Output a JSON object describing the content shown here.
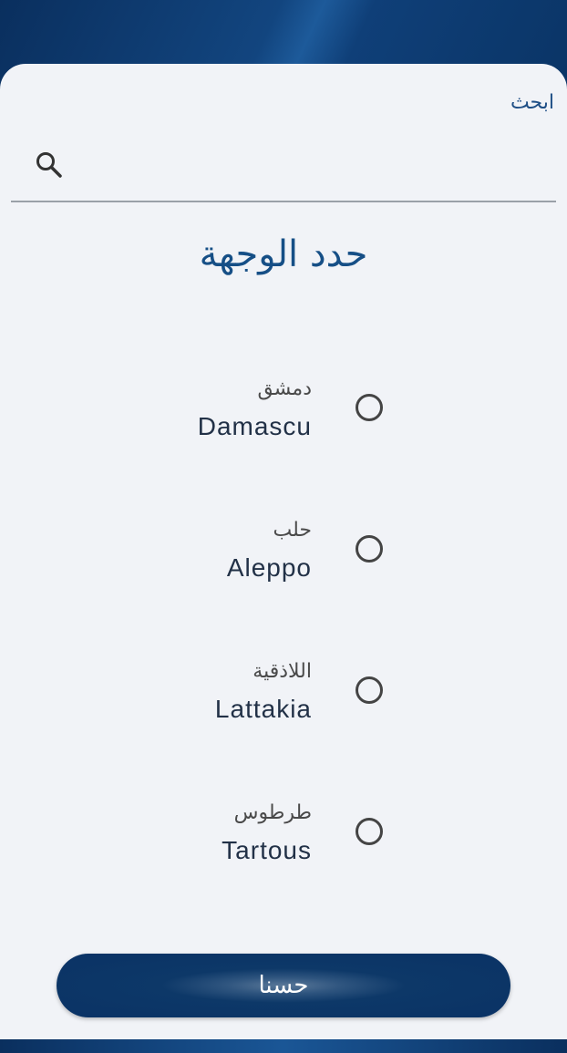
{
  "search": {
    "label": "ابحث",
    "icon": "search-icon"
  },
  "title": "حدد الوجهة",
  "options": [
    {
      "arabic": "دمشق",
      "english": "Damascu",
      "selected": false
    },
    {
      "arabic": "حلب",
      "english": "Aleppo",
      "selected": false
    },
    {
      "arabic": "اللاذقية",
      "english": "Lattakia",
      "selected": false
    },
    {
      "arabic": "طرطوس",
      "english": "Tartous",
      "selected": false
    }
  ],
  "confirm_button": {
    "label": "حسنا"
  },
  "colors": {
    "primary": "#0d3868",
    "accent_text": "#164f86",
    "sheet_bg": "#f1f3f7"
  }
}
